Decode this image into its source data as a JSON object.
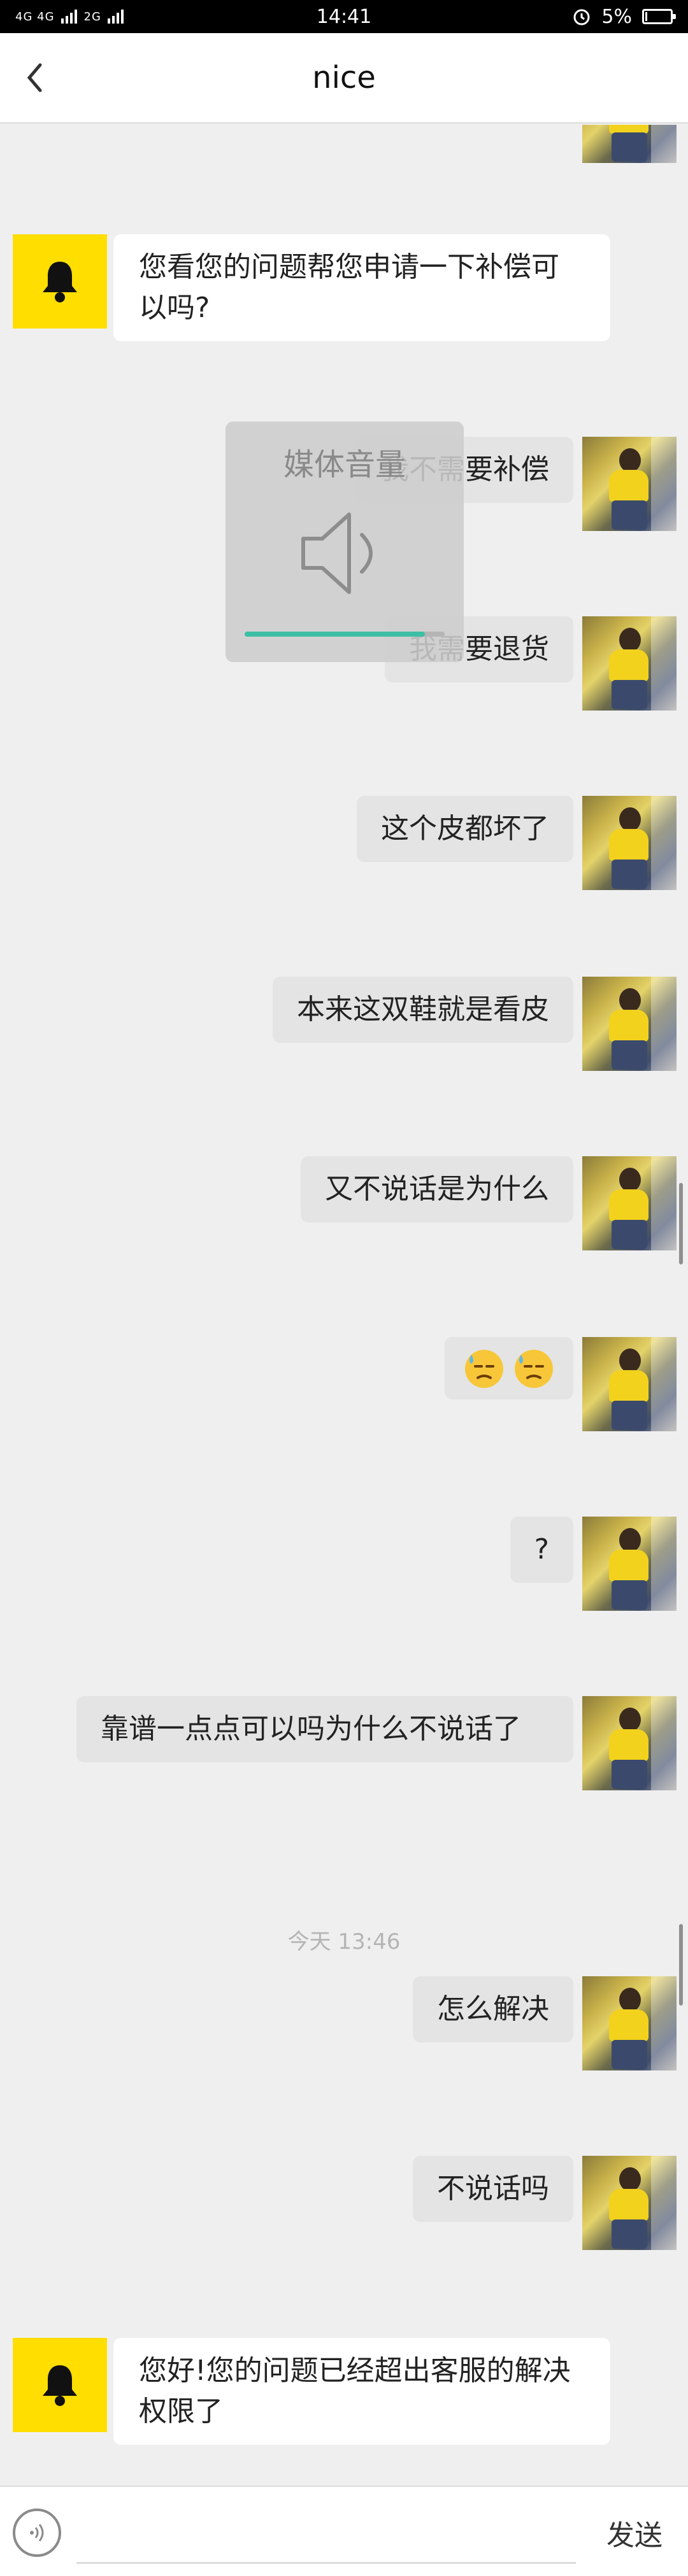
{
  "status_bar": {
    "network_left": "4G 4G",
    "network_right": "2G",
    "time": "14:41",
    "battery_text": "5%",
    "battery_level": 0.05
  },
  "header": {
    "title": "nice",
    "back_icon": "chevron-left-icon"
  },
  "volume_overlay": {
    "label": "媒体音量",
    "icon": "speaker-icon",
    "level": 0.9
  },
  "messages": [
    {
      "side": "in",
      "text": "您看您的问题帮您申请一下补偿可以吗?"
    },
    {
      "side": "out",
      "text": "我不需要补偿"
    },
    {
      "side": "out",
      "text": "我需要退货"
    },
    {
      "side": "out",
      "text": "这个皮都坏了"
    },
    {
      "side": "out",
      "text": "本来这双鞋就是看皮"
    },
    {
      "side": "out",
      "text": "又不说话是为什么"
    },
    {
      "side": "out",
      "text": "😓😓"
    },
    {
      "side": "out",
      "text": "?"
    },
    {
      "side": "out",
      "text": "靠谱一点点可以吗为什么不说话了"
    },
    {
      "side": "time",
      "text": "今天 13:46"
    },
    {
      "side": "out",
      "text": "怎么解决"
    },
    {
      "side": "out",
      "text": "不说话吗"
    },
    {
      "side": "in",
      "text": "您好!您的问题已经超出客服的解决权限了"
    }
  ],
  "input_bar": {
    "voice_icon": "voice-icon",
    "placeholder": "",
    "send_label": "发送"
  },
  "colors": {
    "bot_avatar": "#ffde00",
    "bubble_in": "#ffffff",
    "bubble_out": "#e4e4e4",
    "background": "#efefef",
    "volume_fill": "#3dbfa5"
  }
}
